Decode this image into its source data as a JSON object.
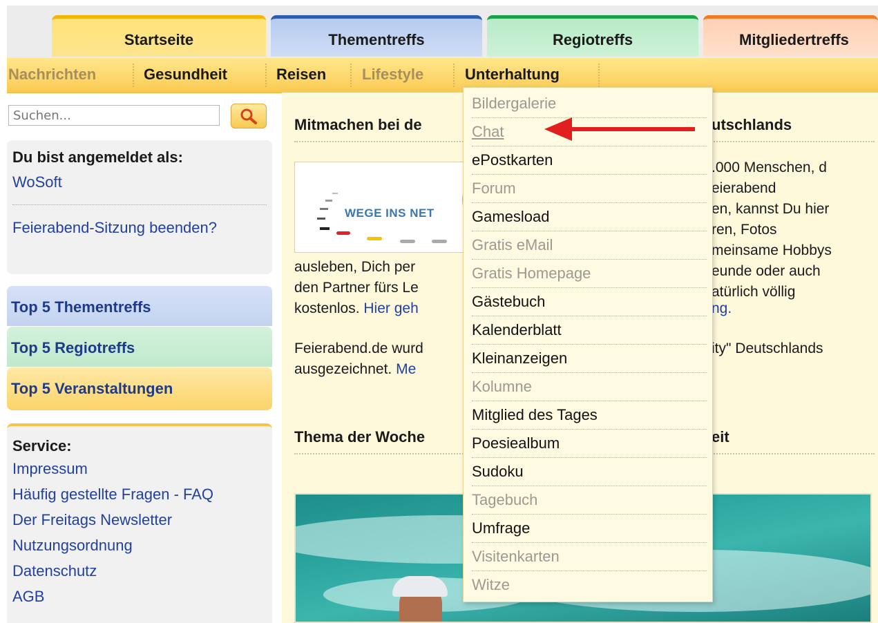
{
  "tabs": {
    "startseite": "Startseite",
    "thementreffs": "Thementreffs",
    "regiotreffs": "Regiotreffs",
    "mitgliedertreffs": "Mitgliedertreffs"
  },
  "subnav": {
    "items": [
      "Nachrichten",
      "Gesundheit",
      "Reisen",
      "Lifestyle",
      "Unterhaltung"
    ]
  },
  "search": {
    "placeholder": "Suchen..."
  },
  "login": {
    "title": "Du bist angemeldet als:",
    "user": "WoSoft",
    "logout": "Feierabend-Sitzung beenden?"
  },
  "top5": {
    "themen": "Top 5 Thementreffs",
    "regio": "Top 5 Regiotreffs",
    "veranstaltungen": "Top 5 Veranstaltungen"
  },
  "service": {
    "title": "Service:",
    "links": [
      "Impressum",
      "Häufig gestellte Fragen - FAQ",
      "Der Freitags Newsletter",
      "Nutzungsordnung",
      "Datenschutz",
      "AGB"
    ]
  },
  "main": {
    "heading1_left": "Mitmachen bei de",
    "heading1_right": "utschlands",
    "banner_text": "WEGE INS NET",
    "right_lines": [
      ".000 Menschen, d",
      "eierabend",
      "en, kannst Du hier",
      "ren, Fotos",
      "meinsame Hobbys",
      "eunde oder auch",
      "atürlich völlig"
    ],
    "left_lines": [
      "ausleben, Dich per",
      "den Partner fürs Le",
      "kostenlos. "
    ],
    "link_left": "Hier geh",
    "link_right": "ng.",
    "para2_left1": "Feierabend.de wurd",
    "para2_left2": "ausgezeichnet. ",
    "para2_link": "Me",
    "para2_right": "ity\" Deutschlands",
    "heading2_left": "Thema der Woche",
    "heading2_right": "eit"
  },
  "dropdown": {
    "items": [
      {
        "label": "Bildergalerie",
        "style": "gray"
      },
      {
        "label": "Chat",
        "style": "chat"
      },
      {
        "label": "ePostkarten",
        "style": "normal"
      },
      {
        "label": "Forum",
        "style": "gray"
      },
      {
        "label": "Gamesload",
        "style": "normal"
      },
      {
        "label": "Gratis eMail",
        "style": "gray"
      },
      {
        "label": "Gratis Homepage",
        "style": "gray"
      },
      {
        "label": "Gästebuch",
        "style": "normal"
      },
      {
        "label": "Kalenderblatt",
        "style": "normal"
      },
      {
        "label": "Kleinanzeigen",
        "style": "normal"
      },
      {
        "label": "Kolumne",
        "style": "gray"
      },
      {
        "label": "Mitglied des Tages",
        "style": "normal"
      },
      {
        "label": "Poesiealbum",
        "style": "normal"
      },
      {
        "label": "Sudoku",
        "style": "normal"
      },
      {
        "label": "Tagebuch",
        "style": "gray"
      },
      {
        "label": "Umfrage",
        "style": "normal"
      },
      {
        "label": "Visitenkarten",
        "style": "gray"
      },
      {
        "label": "Witze",
        "style": "gray"
      }
    ]
  },
  "colors": {
    "link": "#2140a0",
    "arrow": "#e21f1f",
    "tab_start": "#f2b705",
    "tab_themen": "#2c5db0",
    "tab_regio": "#1ca34a",
    "tab_mitglied": "#f07b22"
  }
}
